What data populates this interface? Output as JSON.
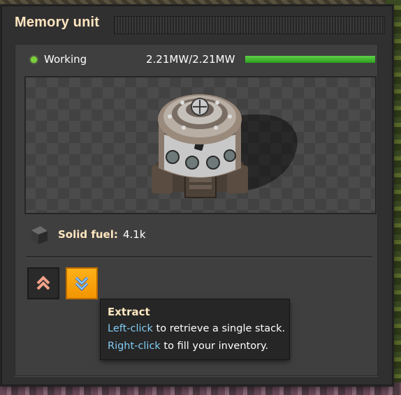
{
  "window": {
    "title": "Memory unit"
  },
  "status": {
    "text": "Working",
    "color": "#7ad23a",
    "power_text": "2.21MW/2.21MW",
    "power_fraction": 1.0
  },
  "fuel": {
    "label": "Solid fuel:",
    "value": "4.1k",
    "icon": "solid-fuel-icon"
  },
  "buttons": {
    "insert_icon": "double-chevron-up-icon",
    "extract_icon": "double-chevron-down-icon"
  },
  "tooltip": {
    "title": "Extract",
    "line1_key": "Left-click",
    "line1_rest": " to retrieve a single stack.",
    "line2_key": "Right-click",
    "line2_rest": " to fill your inventory."
  },
  "colors": {
    "accent_orange": "#f29400",
    "key_blue": "#80ccf5",
    "title_cream": "#ffe6c0",
    "power_green": "#3cb82a"
  }
}
